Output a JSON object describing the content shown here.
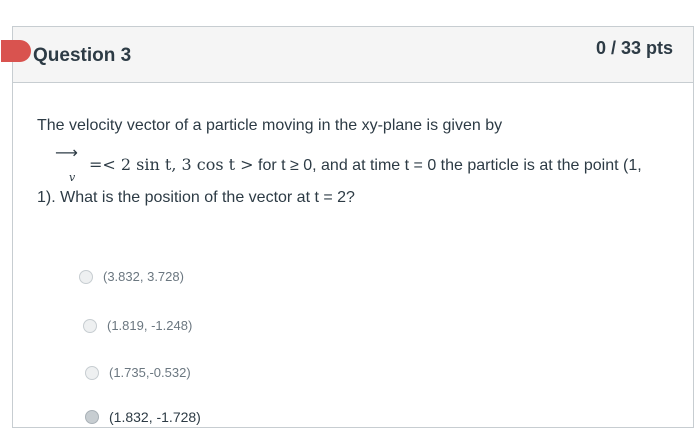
{
  "question": {
    "title": "Question 3",
    "points": "0 / 33 pts",
    "text_line1": "The velocity vector of a particle moving in the xy-plane is given by",
    "vector_symbol": "v",
    "vector_expr": "=< 2 sin t, 3 cos t >",
    "text_line2_rest": " for t ≥ 0, and at time t = 0 the particle is at the point (1,",
    "text_line3": "1). What is the position of the vector at t = 2?"
  },
  "answers": [
    {
      "label": "(3.832, 3.728)",
      "selected": false
    },
    {
      "label": "(1.819, -1.248)",
      "selected": false
    },
    {
      "label": "(1.735,-0.532)",
      "selected": false
    },
    {
      "label": "(1.832, -1.728)",
      "selected": true
    }
  ],
  "colors": {
    "flag": "#d9534f",
    "text": "#2d3b45",
    "header_bg": "#f5f5f5"
  }
}
